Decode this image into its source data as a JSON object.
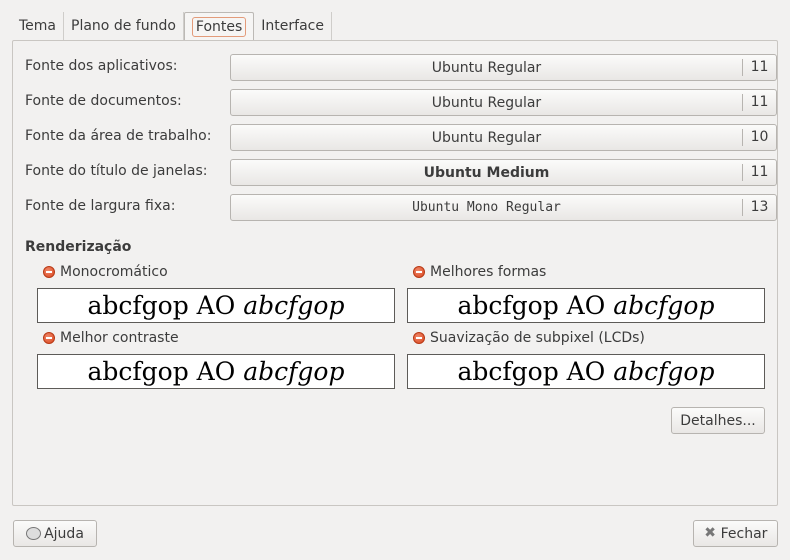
{
  "tabs": [
    {
      "label": "Tema"
    },
    {
      "label": "Plano de fundo"
    },
    {
      "label": "Fontes"
    },
    {
      "label": "Interface"
    }
  ],
  "fonts": [
    {
      "label": "Fonte dos aplicativos:",
      "name": "Ubuntu Regular",
      "size": "11"
    },
    {
      "label": "Fonte de documentos:",
      "name": "Ubuntu Regular",
      "size": "11"
    },
    {
      "label": "Fonte da área de trabalho:",
      "name": "Ubuntu Regular",
      "size": "10"
    },
    {
      "label": "Fonte do título de janelas:",
      "name": "Ubuntu Medium",
      "size": "11"
    },
    {
      "label": "Fonte de largura fixa:",
      "name": "Ubuntu Mono Regular",
      "size": "13"
    }
  ],
  "rendering": {
    "title": "Renderização",
    "options": [
      {
        "label": "Monocromático",
        "sample": "abcfgop AO",
        "sample_italic": "abcfgop"
      },
      {
        "label": "Melhores formas",
        "sample": "abcfgop AO",
        "sample_italic": "abcfgop"
      },
      {
        "label": "Melhor contraste",
        "sample": "abcfgop AO",
        "sample_italic": "abcfgop"
      },
      {
        "label": "Suavização de subpixel (LCDs)",
        "sample": "abcfgop AO",
        "sample_italic": "abcfgop"
      }
    ]
  },
  "buttons": {
    "details": "Detalhes...",
    "help": "Ajuda",
    "close": "Fechar"
  }
}
